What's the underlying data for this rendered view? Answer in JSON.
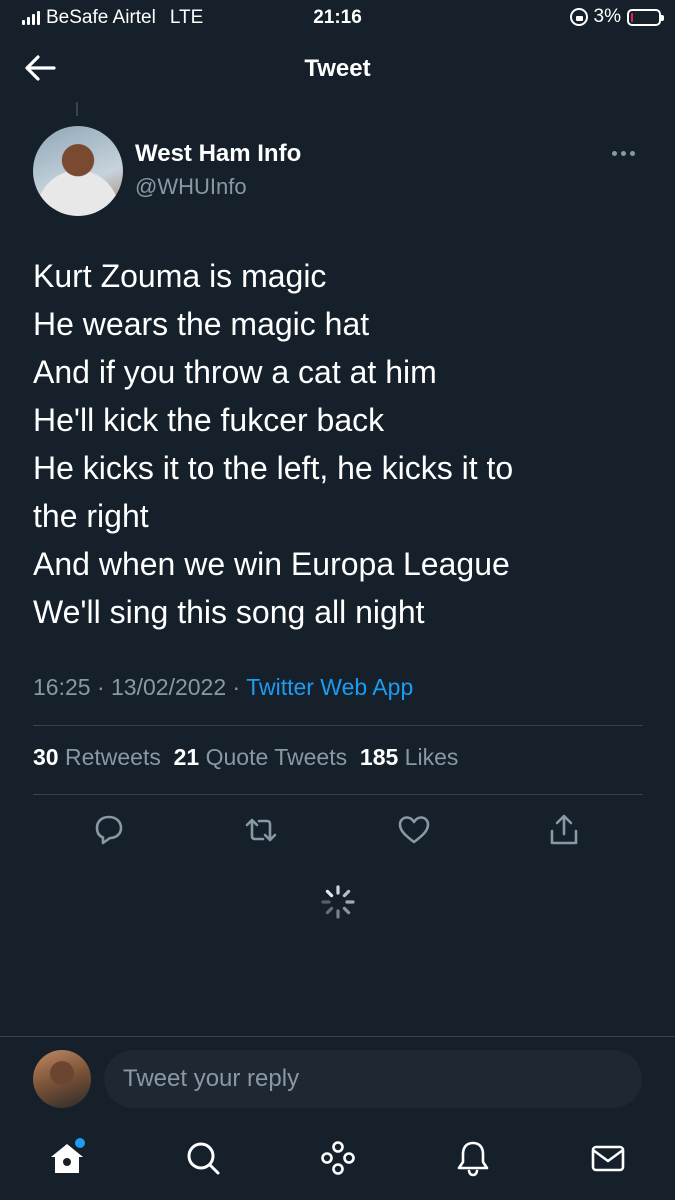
{
  "status_bar": {
    "carrier": "BeSafe Airtel",
    "network": "LTE",
    "time": "21:16",
    "battery": "3%"
  },
  "header": {
    "title": "Tweet"
  },
  "tweet": {
    "author_name": "West Ham Info",
    "author_handle": "@WHUInfo",
    "lines": [
      "Kurt Zouma is magic",
      "He wears the magic hat",
      "And if you throw a cat at him",
      "He'll kick the fukcer back",
      "He kicks it to the left, he kicks it to",
      "the right",
      "And when we win Europa League",
      "We'll sing this song all night"
    ],
    "time": "16:25",
    "date": "13/02/2022",
    "separator": "·",
    "source": "Twitter Web App"
  },
  "stats": {
    "retweets_count": "30",
    "retweets_label": "Retweets",
    "quotes_count": "21",
    "quotes_label": "Quote Tweets",
    "likes_count": "185",
    "likes_label": "Likes"
  },
  "actions": [
    "reply-icon",
    "retweet-icon",
    "like-icon",
    "share-icon"
  ],
  "reply_bar": {
    "placeholder": "Tweet your reply"
  },
  "tabbar": [
    "home-icon",
    "search-icon",
    "spaces-icon",
    "notifications-icon",
    "messages-icon"
  ],
  "colors": {
    "background": "#15202b",
    "accent": "#1d9bf0",
    "secondary_text": "#8899a6",
    "divider": "#38444d",
    "battery_low": "#e0245e"
  }
}
